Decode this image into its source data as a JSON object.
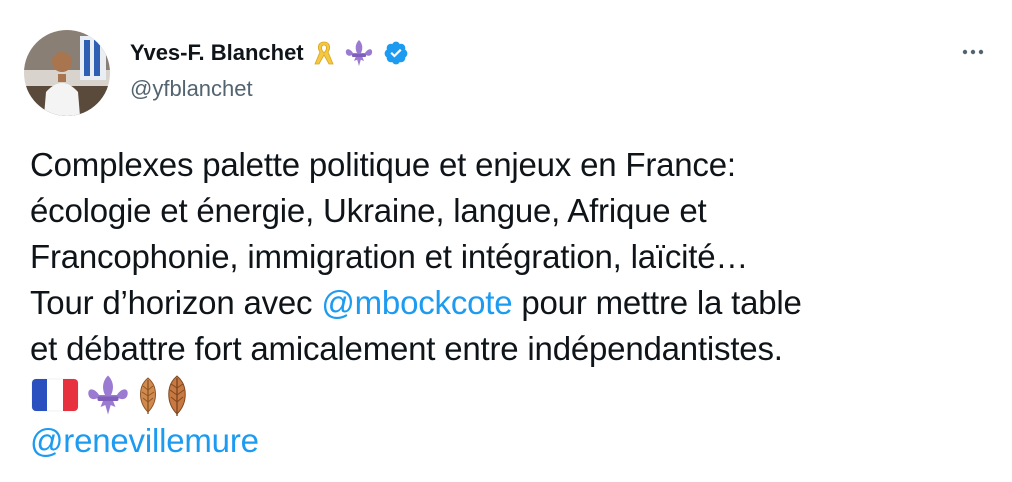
{
  "author": {
    "display_name": "Yves-F. Blanchet",
    "handle": "@yfblanchet",
    "name_emojis": [
      "yellow-ribbon-icon",
      "fleur-de-lis-icon",
      "verified-badge-icon"
    ]
  },
  "tweet": {
    "line1": "Complexes palette politique et enjeux en France:",
    "line2": "écologie et énergie, Ukraine, langue, Afrique et",
    "line3": "Francophonie, immigration et intégration, laïcité…",
    "line4_before": "Tour d’horizon avec ",
    "line4_mention": "@mbockcote",
    "line4_after": " pour mettre la table",
    "line5": "et débattre fort amicalement entre indépendantistes.",
    "emojis": [
      "france-flag-icon",
      "fleur-de-lis-icon",
      "leaf-icon",
      "leaf-icon"
    ],
    "mention2": "@renevillemure"
  },
  "colors": {
    "text": "#0f1419",
    "secondary": "#536471",
    "link": "#1d9bf0",
    "verified": "#1d9bf0",
    "fleur": "#9b7bd1",
    "ribbon": "#f5c842",
    "leaf": "#c87941"
  }
}
